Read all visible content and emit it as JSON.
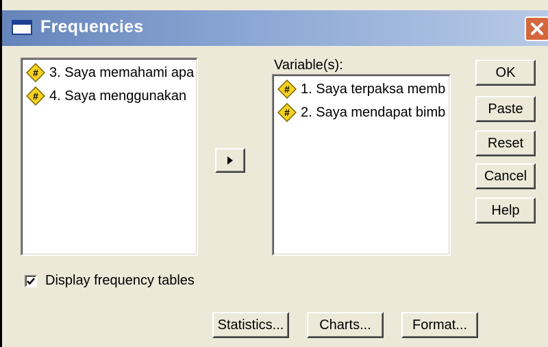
{
  "window": {
    "title": "Frequencies",
    "close_icon": "close-icon"
  },
  "source_list": {
    "items": [
      {
        "label": "3. Saya memahami apa",
        "icon": "numeric-variable-icon"
      },
      {
        "label": "4. Saya menggunakan",
        "icon": "numeric-variable-icon"
      }
    ]
  },
  "transfer_button": {
    "icon": "right-arrow-icon"
  },
  "variables": {
    "label": "Variable(s):",
    "items": [
      {
        "label": "1. Saya terpaksa memb",
        "icon": "numeric-variable-icon"
      },
      {
        "label": "2. Saya mendapat bimb",
        "icon": "numeric-variable-icon"
      }
    ]
  },
  "buttons": {
    "ok": "OK",
    "paste": "Paste",
    "reset": "Reset",
    "cancel": "Cancel",
    "help": "Help"
  },
  "checkbox": {
    "label": "Display frequency tables",
    "checked": true
  },
  "bottom_buttons": {
    "statistics": "Statistics...",
    "charts": "Charts...",
    "format": "Format..."
  }
}
